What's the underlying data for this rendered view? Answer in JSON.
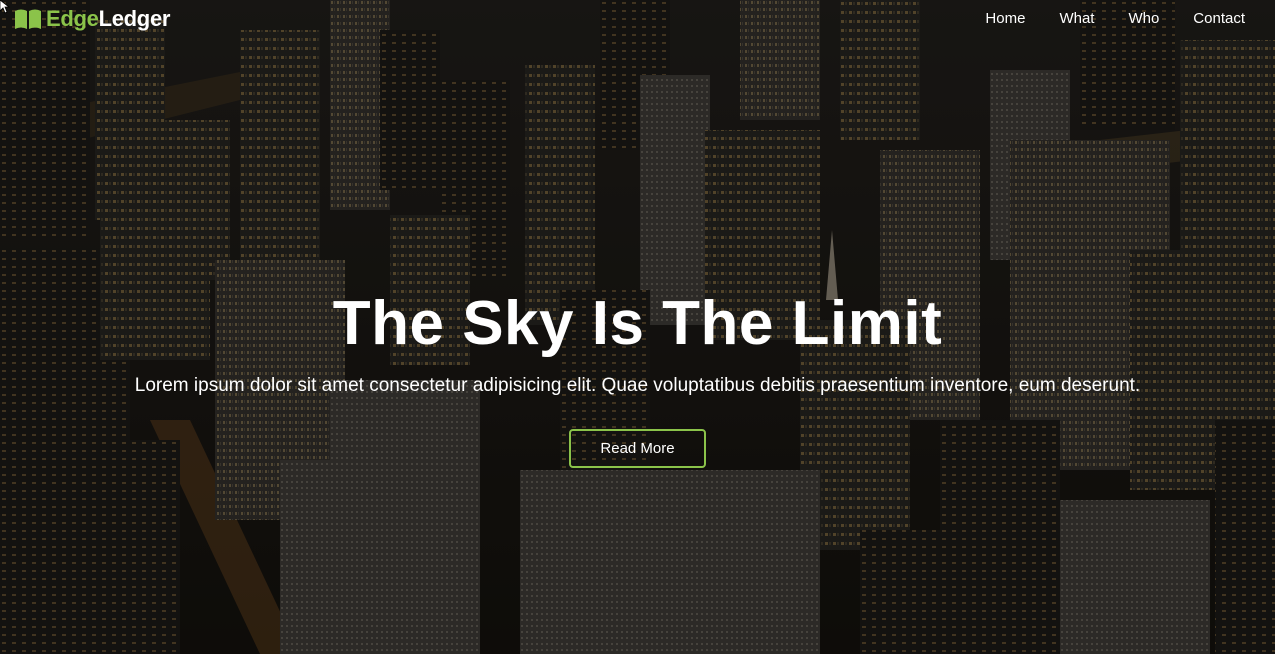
{
  "brand": {
    "name_part1": "Edge",
    "name_part2": "Ledger",
    "icon": "book-icon",
    "accent_color": "#8bc34a"
  },
  "nav": {
    "items": [
      {
        "label": "Home"
      },
      {
        "label": "What"
      },
      {
        "label": "Who"
      },
      {
        "label": "Contact"
      }
    ]
  },
  "hero": {
    "title": "The Sky Is The Limit",
    "subtitle": "Lorem ipsum dolor sit amet consectetur adipisicing elit. Quae voluptatibus debitis praesentium inventore, eum deserunt.",
    "button_label": "Read More",
    "background": "night-city-aerial-photo",
    "button_border_color": "#8bc34a"
  }
}
